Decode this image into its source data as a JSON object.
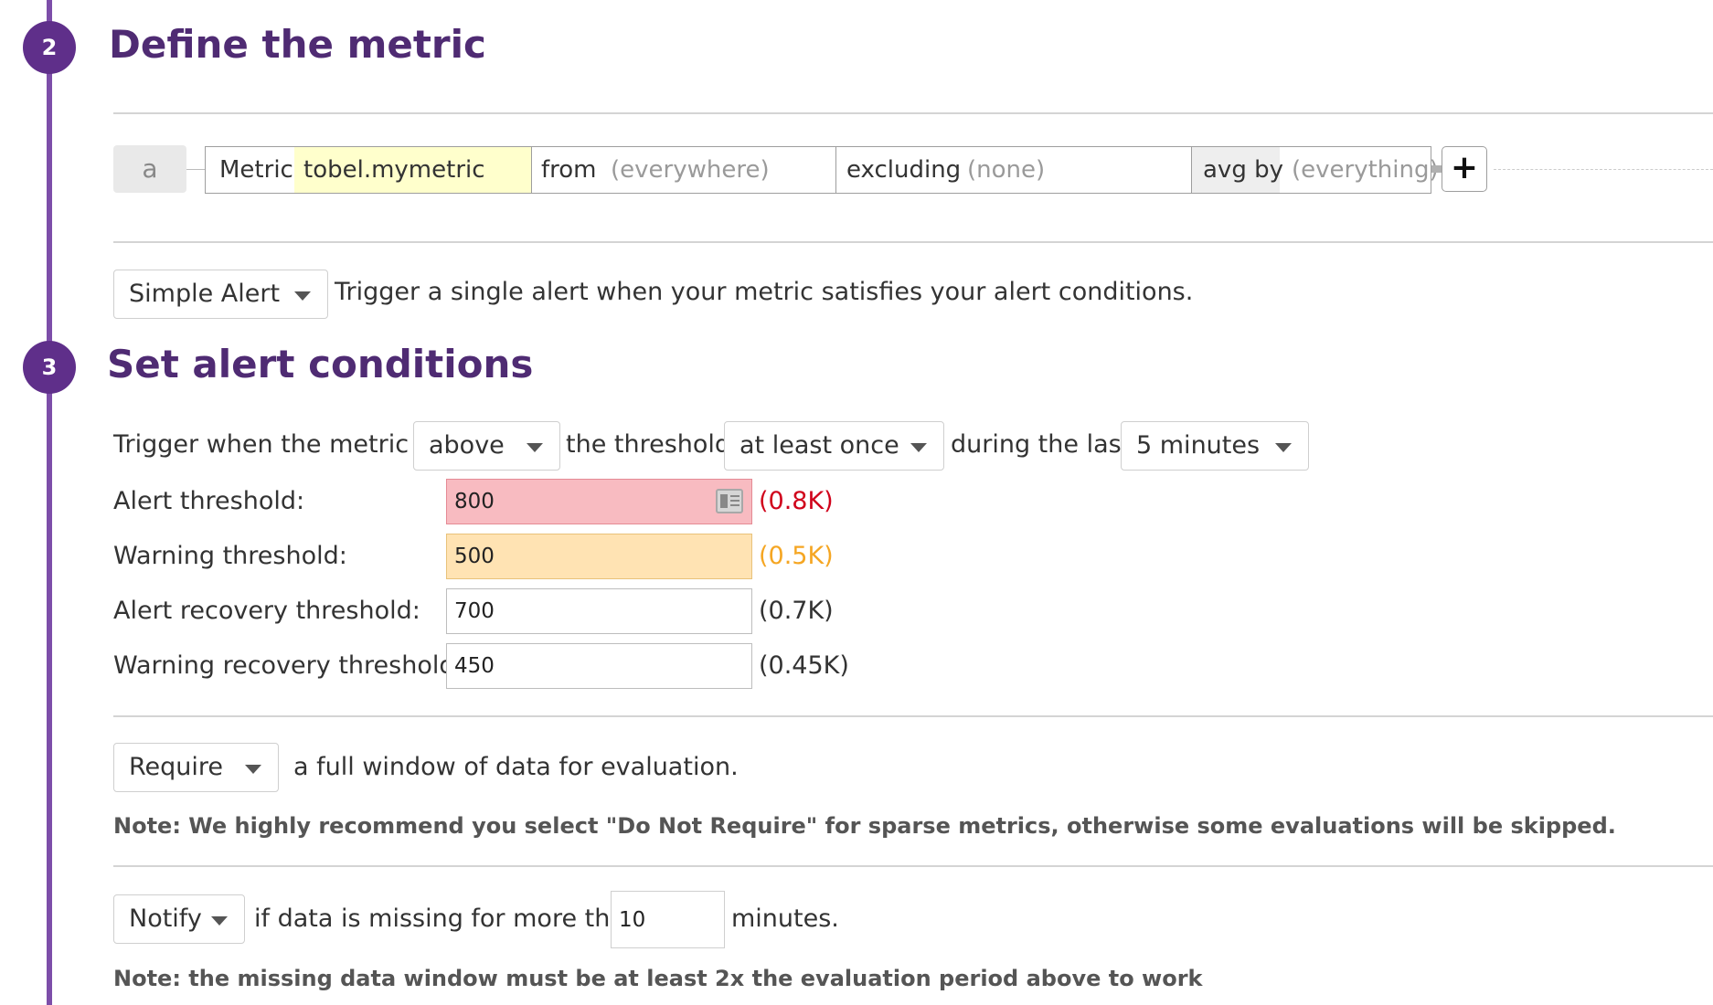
{
  "section2": {
    "step_number": "2",
    "title": "Define the metric"
  },
  "query": {
    "row_label": "a",
    "metric_key": "Metric",
    "metric_value": "tobel.mymetric",
    "from_key": "from",
    "from_value": "(everywhere)",
    "excluding_key": "excluding",
    "excluding_value": "(none)",
    "avgby_key": "avg by",
    "avgby_value": "(everything)",
    "add_symbol": "+"
  },
  "alert_type": {
    "selected": "Simple Alert",
    "description": "Trigger a single alert when your metric satisfies your alert conditions."
  },
  "section3": {
    "step_number": "3",
    "title": "Set alert conditions"
  },
  "trigger": {
    "prefix": "Trigger when the metric is",
    "comparator": "above",
    "mid": "the threshold",
    "frequency": "at least once",
    "during": "during the last",
    "window": "5 minutes"
  },
  "thresholds": [
    {
      "label": "Alert threshold:",
      "value": "800",
      "hint": "(0.8K)",
      "hint_color": "#d0021b"
    },
    {
      "label": "Warning threshold:",
      "value": "500",
      "hint": "(0.5K)",
      "hint_color": "#f5a623"
    },
    {
      "label": "Alert recovery threshold:",
      "value": "700",
      "hint": "(0.7K)",
      "hint_color": "#333333"
    },
    {
      "label": "Warning recovery threshold:",
      "value": "450",
      "hint": "(0.45K)",
      "hint_color": "#333333"
    }
  ],
  "require": {
    "selected": "Require",
    "text": "a full window of data for evaluation.",
    "note": "Note: We highly recommend you select \"Do Not Require\" for sparse metrics, otherwise some evaluations will be skipped."
  },
  "notify": {
    "selected": "Notify",
    "text": "if data is missing for more than",
    "minutes_value": "10",
    "suffix": "minutes.",
    "note": "Note: the missing data window must be at least 2x the evaluation period above to work"
  },
  "colors": {
    "accent_purple": "#5f2f8a",
    "alert_bg": "#f8bbc1",
    "warning_bg": "#ffe3b3",
    "metric_highlight": "#ffffcc"
  }
}
